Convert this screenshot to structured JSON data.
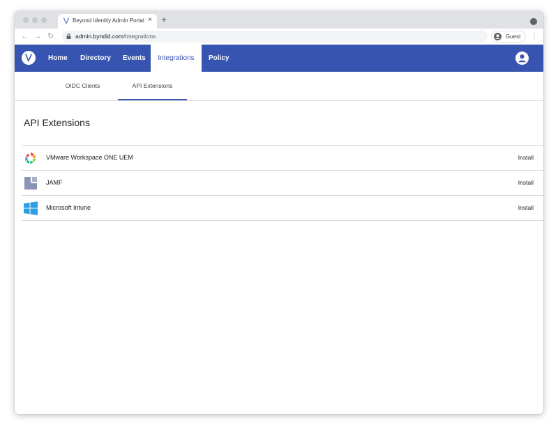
{
  "browser": {
    "tab_title": "Beyond Identity Admin Portal",
    "tab_close": "×",
    "new_tab": "+",
    "back": "←",
    "forward": "→",
    "reload": "↻",
    "url_host": "admin.byndid.com",
    "url_path": "/integrations",
    "profile_label": "Guest",
    "menu": "⋮"
  },
  "appnav": {
    "items": [
      "Home",
      "Directory",
      "Events",
      "Integrations",
      "Policy"
    ],
    "active": "Integrations"
  },
  "subnav": {
    "tabs": [
      "OIDC Clients",
      "API Extensions"
    ],
    "active": "API Extensions"
  },
  "page": {
    "title": "API Extensions"
  },
  "extensions": [
    {
      "name": "VMware Workspace ONE UEM",
      "icon": "vmware-icon",
      "action": "Install"
    },
    {
      "name": "JAMF",
      "icon": "jamf-icon",
      "action": "Install"
    },
    {
      "name": "Microsoft Intune",
      "icon": "windows-icon",
      "action": "Install"
    }
  ],
  "colors": {
    "nav_bg": "#3754b0",
    "active_underline": "#3754b0"
  }
}
